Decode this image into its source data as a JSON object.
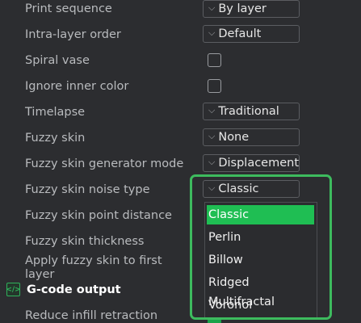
{
  "settings": [
    {
      "label": "Print sequence",
      "control": "combo",
      "value": "By layer"
    },
    {
      "label": "Intra-layer order",
      "control": "combo",
      "value": "Default"
    },
    {
      "label": "Spiral vase",
      "control": "checkbox"
    },
    {
      "label": "Ignore inner color",
      "control": "checkbox"
    },
    {
      "label": "Timelapse",
      "control": "combo",
      "value": "Traditional"
    },
    {
      "label": "Fuzzy skin",
      "control": "combo",
      "value": "None"
    },
    {
      "label": "Fuzzy skin generator mode",
      "control": "combo",
      "value": "Displacement"
    },
    {
      "label": "Fuzzy skin noise type",
      "control": "combo",
      "value": "Classic"
    },
    {
      "label": "Fuzzy skin point distance"
    },
    {
      "label": "Fuzzy skin thickness"
    },
    {
      "label": "Apply fuzzy skin to first layer"
    }
  ],
  "section": {
    "title": "G-code output",
    "icon": "gcode-icon"
  },
  "after_section": [
    {
      "label": "Reduce infill retraction",
      "control": "checkbox"
    }
  ],
  "dropdown": {
    "options": [
      "Classic",
      "Perlin",
      "Billow",
      "Ridged Multifractal",
      "Voronoi"
    ],
    "selected": "Classic"
  },
  "colors": {
    "accent": "#1fbe53",
    "highlight": "#3dbb5e",
    "background": "#2c2d30"
  }
}
